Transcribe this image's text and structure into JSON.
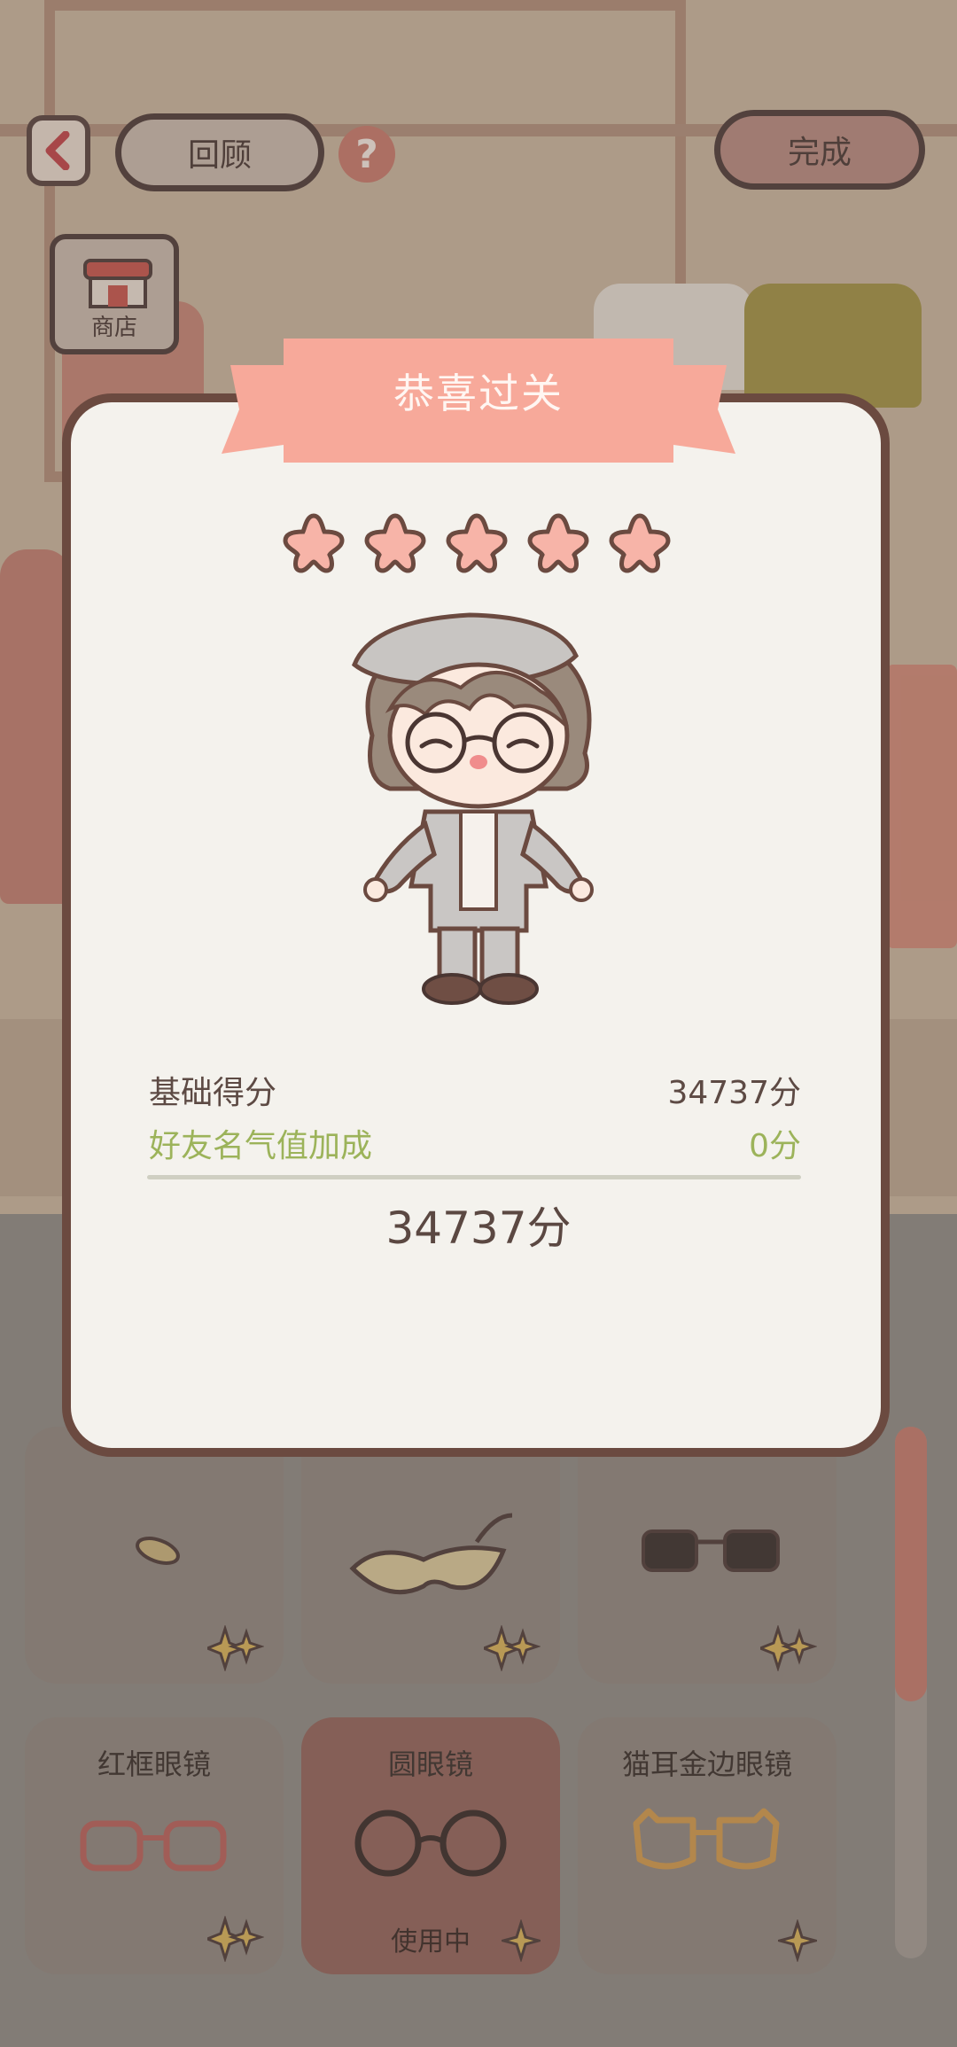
{
  "topbar": {
    "review_label": "回顾",
    "help_symbol": "?",
    "done_label": "完成"
  },
  "shop": {
    "label": "商店"
  },
  "modal": {
    "title": "恭喜过关",
    "stars_earned": 5,
    "stars_total": 5,
    "base_score_label": "基础得分",
    "base_score_value": "34737分",
    "bonus_label": "好友名气值加成",
    "bonus_value": "0分",
    "total_score": "34737分"
  },
  "items": [
    {
      "name": "",
      "status": ""
    },
    {
      "name": "",
      "status": ""
    },
    {
      "name": "",
      "status": ""
    },
    {
      "name": "红框眼镜",
      "status": ""
    },
    {
      "name": "圆眼镜",
      "status": "使用中"
    },
    {
      "name": "猫耳金边眼镜",
      "status": ""
    }
  ],
  "colors": {
    "accent": "#f7a99a",
    "border": "#6b4a40",
    "bonus_green": "#9cb35a",
    "star": "#f7b4a8"
  }
}
